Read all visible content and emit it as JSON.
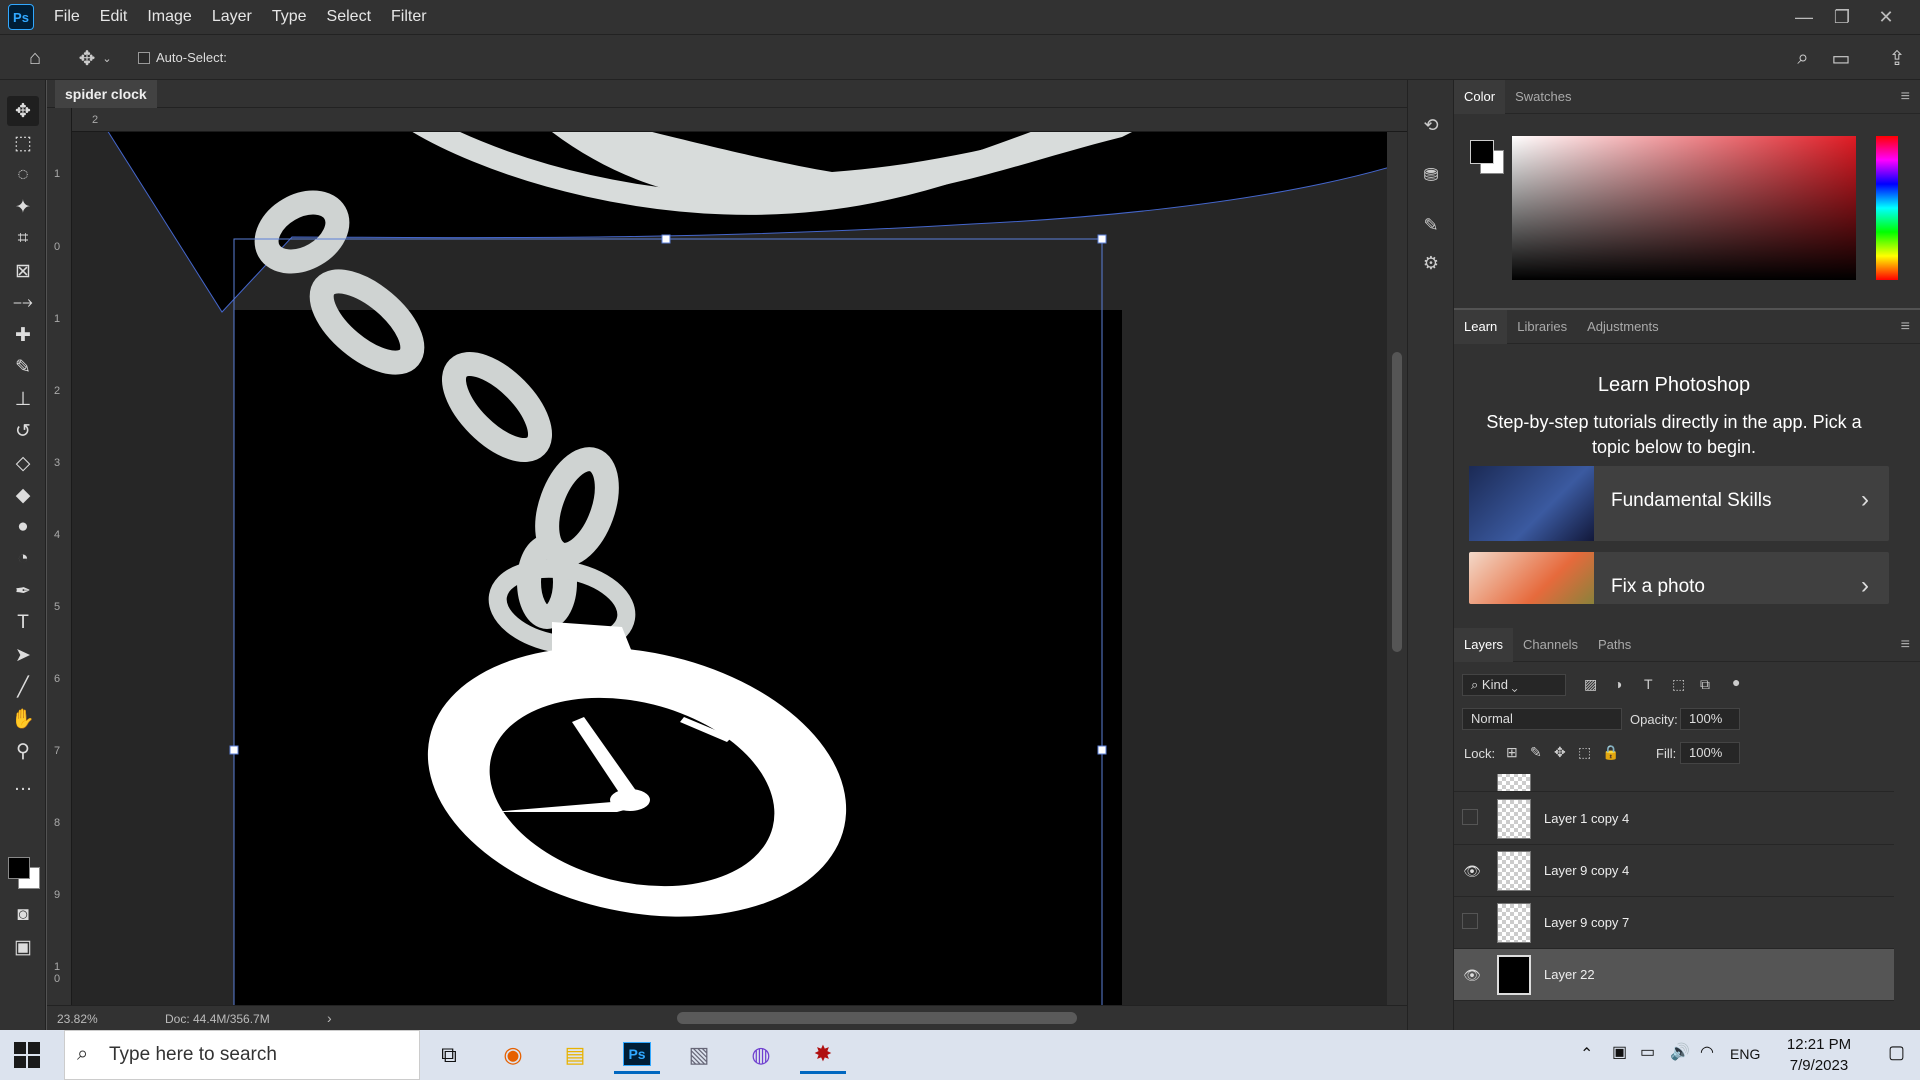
{
  "app": {
    "logo": "Ps",
    "menu": [
      "File",
      "Edit",
      "Image",
      "Layer",
      "Type",
      "Select",
      "Filter"
    ]
  },
  "options": {
    "auto_select": "Auto-Select:"
  },
  "document": {
    "tab": "spider clock",
    "zoom": "23.82%",
    "doc_info": "Doc: 44.4M/356.7M"
  },
  "rulers": {
    "top": [
      "2"
    ],
    "left": [
      "1",
      "0",
      "1",
      "2",
      "3",
      "4",
      "5",
      "6",
      "7",
      "8",
      "9",
      "1",
      "0"
    ]
  },
  "color_panel": {
    "tabs": [
      "Color",
      "Swatches"
    ],
    "foreground": "#000000",
    "background": "#ffffff"
  },
  "learn_panel": {
    "tabs": [
      "Learn",
      "Libraries",
      "Adjustments"
    ],
    "title": "Learn Photoshop",
    "description": "Step-by-step tutorials directly in the app. Pick a topic below to begin.",
    "cards": [
      "Fundamental Skills",
      "Fix a photo"
    ]
  },
  "layers_panel": {
    "tabs": [
      "Layers",
      "Channels",
      "Paths"
    ],
    "filter": "Kind",
    "blend_mode": "Normal",
    "opacity_label": "Opacity:",
    "opacity": "100%",
    "lock_label": "Lock:",
    "fill_label": "Fill:",
    "fill": "100%",
    "layers": [
      {
        "name": "Layer 1 copy 4",
        "visible": false
      },
      {
        "name": "Layer 9 copy 4",
        "visible": true
      },
      {
        "name": "Layer 9 copy 7",
        "visible": false
      },
      {
        "name": "Layer 22",
        "visible": true,
        "selected": true
      }
    ]
  },
  "taskbar": {
    "search_placeholder": "Type here to search",
    "time": "12:21 PM",
    "date": "7/9/2023",
    "lang": "ENG"
  }
}
